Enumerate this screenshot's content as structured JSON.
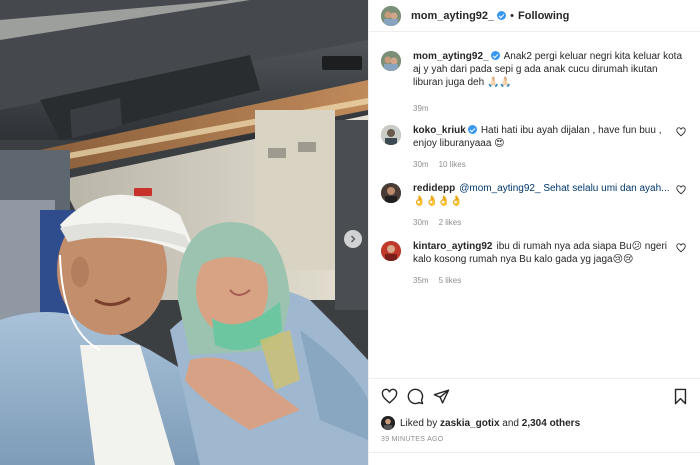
{
  "post": {
    "username": "mom_ayting92_",
    "follow_label": "Following",
    "separator": "•",
    "caption": "Anak2 pergi keluar negri kita keluar kota aj y yah dari pada sepi g ada anak cucu dirumah ikutan liburan juga deh 🙏🏻🙏🏻",
    "caption_time": "39m"
  },
  "comments": [
    {
      "username": "koko_kriuk",
      "verified": true,
      "text": "Hati hati ibu ayah dijalan , have fun buu , enjoy liburanyaaa 😍",
      "time": "30m",
      "likes": "10 likes"
    },
    {
      "username": "redidepp",
      "verified": false,
      "text": "@mom_ayting92_ Sehat selalu umi dan ayah... 👌👌👌👌",
      "time": "30m",
      "likes": "2 likes"
    },
    {
      "username": "kintaro_ayting92",
      "verified": false,
      "text": "ibu di rumah nya ada siapa Bu😕 ngeri kalo kosong rumah nya Bu kalo gada yg jaga😢😢",
      "time": "35m",
      "likes": "5 likes"
    }
  ],
  "likes": {
    "prefix": "Liked by ",
    "user": "zaskia_gotix",
    "middle": " and ",
    "count": "2,304 others"
  },
  "time_ago": "39 MINUTES AGO",
  "icons": {
    "like": "heart-icon",
    "comment": "comment-icon",
    "share": "share-icon",
    "save": "bookmark-icon",
    "next": "chevron-right-icon",
    "verified": "verified-badge-icon"
  },
  "colors": {
    "verified": "#3897f0",
    "muted": "#8e8e8e",
    "text": "#262626",
    "border": "#efefef"
  }
}
